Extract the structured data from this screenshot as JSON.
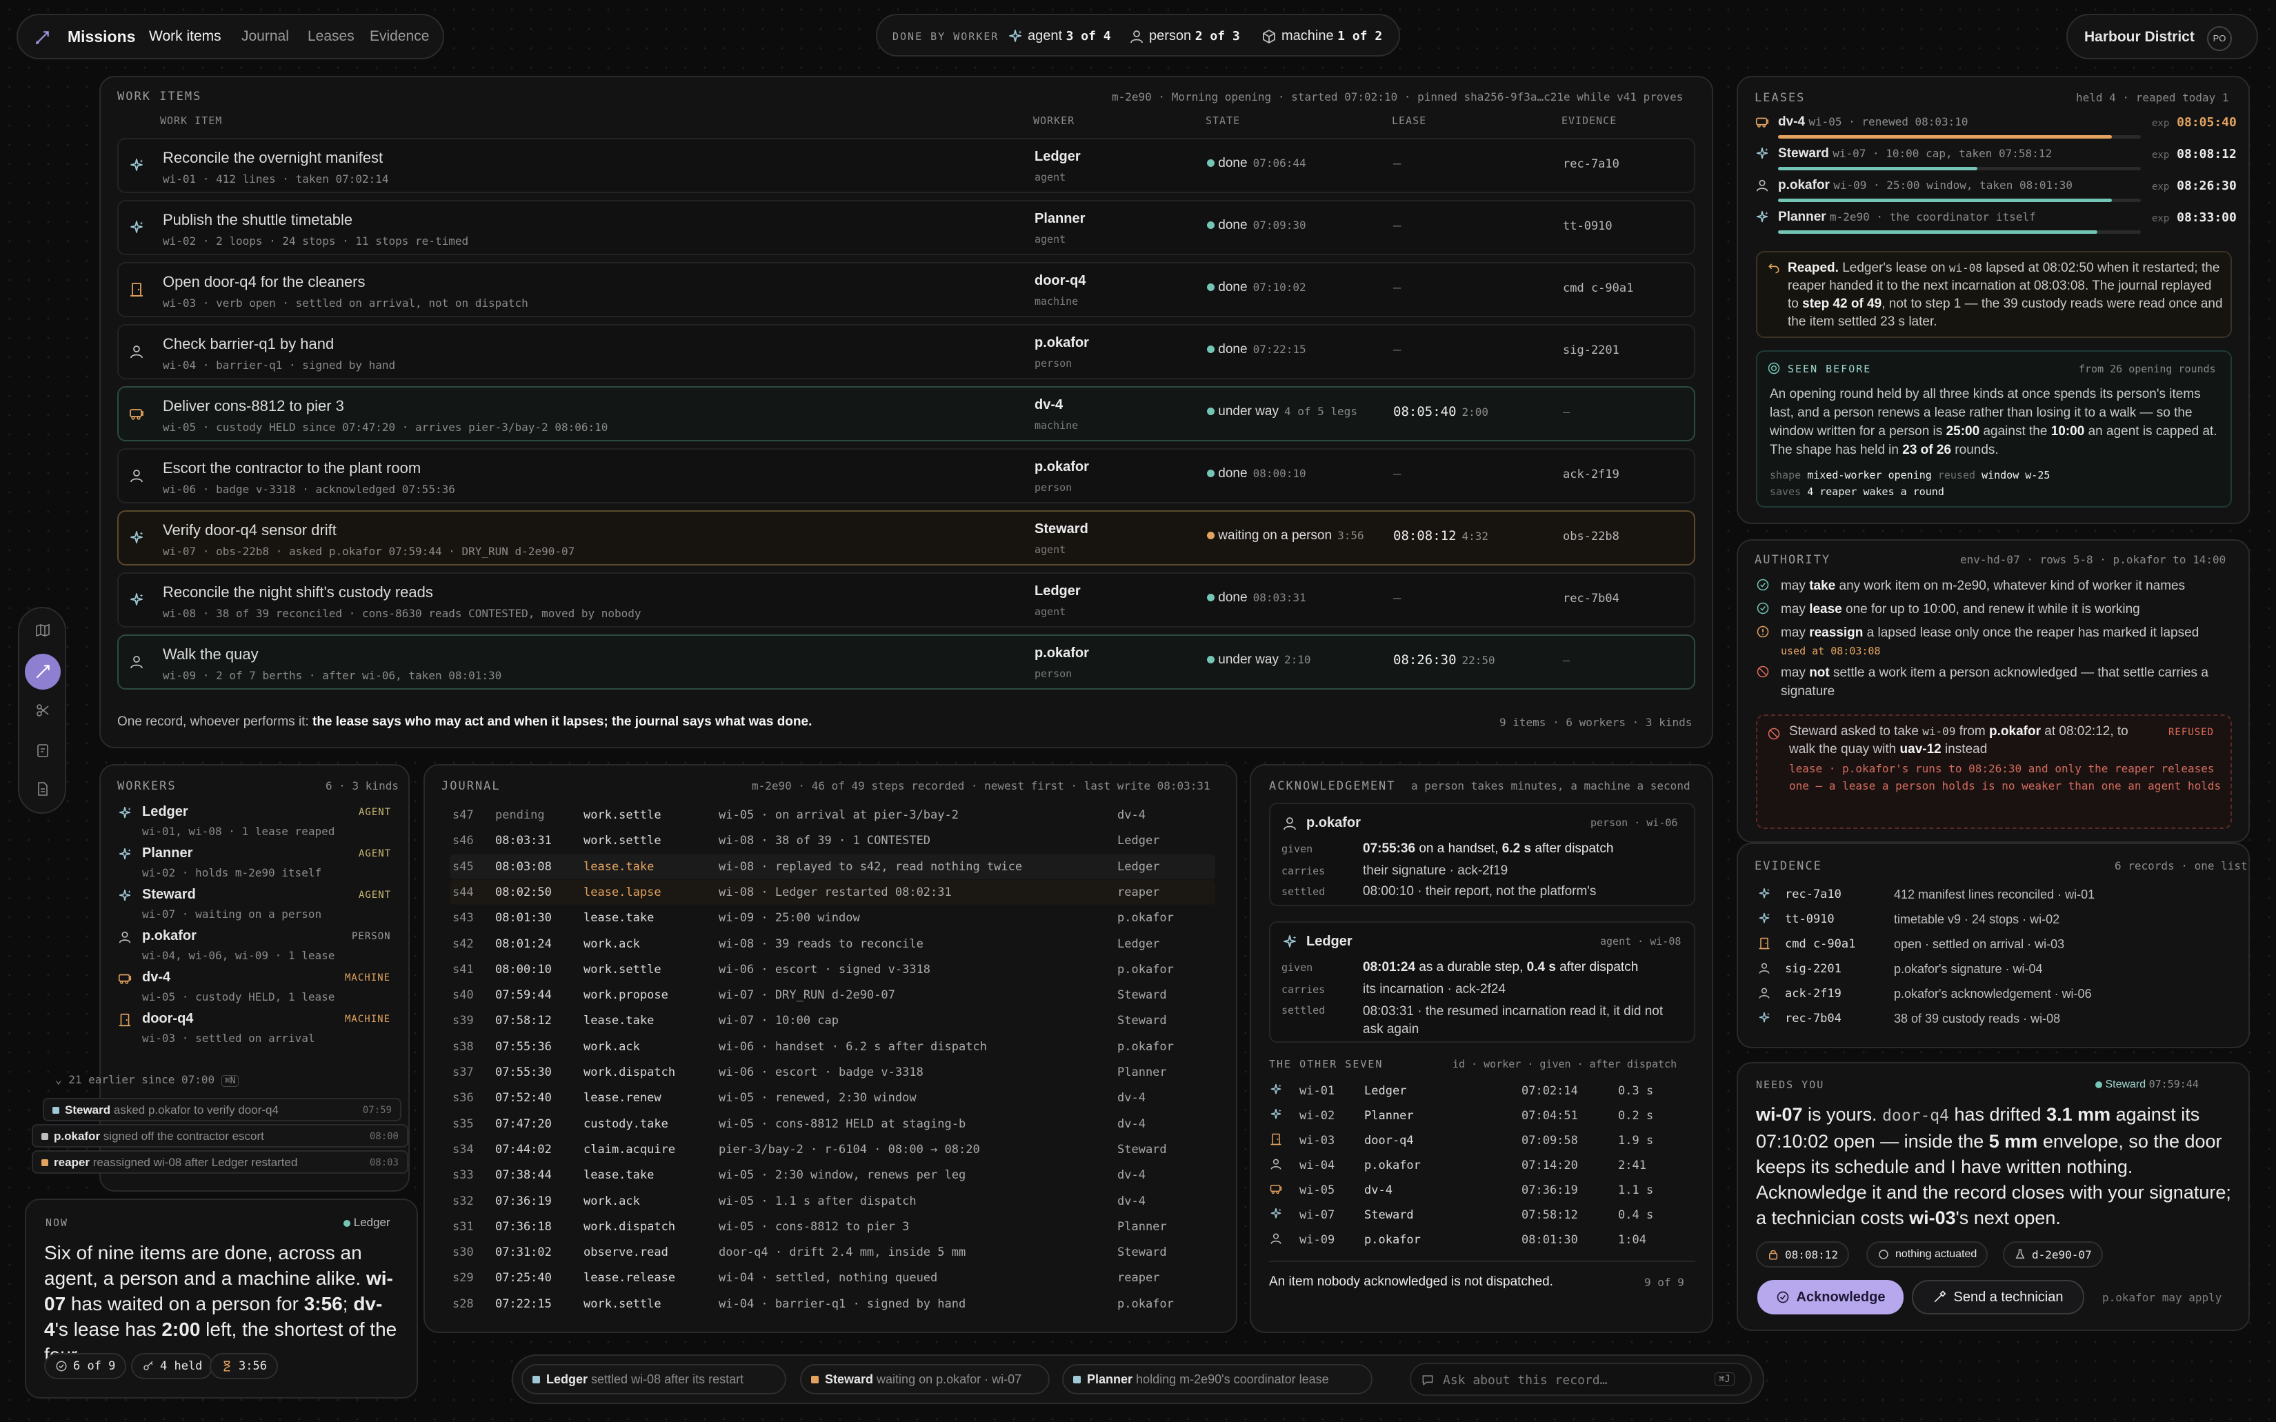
{
  "colors": {
    "accent": "#a594e0",
    "done": "#73c6b6",
    "waiting": "#e3a35f",
    "under_way": "#73c6b6",
    "refused": "#e06b5a",
    "badge_agent": "#c8b872",
    "badge_machine": "#e3a35f"
  },
  "topnav": {
    "title": "Missions",
    "tabs": [
      "Work items",
      "Journal",
      "Leases",
      "Evidence"
    ],
    "active": "Work items"
  },
  "done_by_worker": {
    "label": "DONE BY WORKER",
    "agent_label": "agent",
    "agent_val": "3 of 4",
    "person_label": "person",
    "person_val": "2 of 3",
    "machine_label": "machine",
    "machine_val": "1 of 2"
  },
  "district": {
    "name": "Harbour District",
    "initials": "PO"
  },
  "work_items": {
    "title": "WORK ITEMS",
    "meta": "m-2e90 · Morning opening · started 07:02:10 · pinned sha256-9f3a…c21e while v41 proves",
    "columns": [
      "WORK ITEM",
      "WORKER",
      "STATE",
      "LEASE",
      "EVIDENCE"
    ],
    "rows": [
      {
        "icon": "agent-icon",
        "title": "Reconcile the overnight manifest",
        "meta": "wi-01 · 412 lines · taken 07:02:14",
        "worker": "Ledger",
        "kind": "agent",
        "state": "done",
        "state_time": "07:06:44",
        "lease": "—",
        "lease_extra": "",
        "evidence": "rec-7a10"
      },
      {
        "icon": "agent-icon",
        "title": "Publish the shuttle timetable",
        "meta": "wi-02 · 2 loops · 24 stops · 11 stops re-timed",
        "worker": "Planner",
        "kind": "agent",
        "state": "done",
        "state_time": "07:09:30",
        "lease": "—",
        "lease_extra": "",
        "evidence": "tt-0910"
      },
      {
        "icon": "door-icon",
        "title": "Open door-q4 for the cleaners",
        "meta": "wi-03 · verb open · settled on arrival, not on dispatch",
        "worker": "door-q4",
        "kind": "machine",
        "state": "done",
        "state_time": "07:10:02",
        "lease": "—",
        "lease_extra": "",
        "evidence": "cmd c-90a1"
      },
      {
        "icon": "person-icon",
        "title": "Check barrier-q1 by hand",
        "meta": "wi-04 · barrier-q1 · signed by hand",
        "worker": "p.okafor",
        "kind": "person",
        "state": "done",
        "state_time": "07:22:15",
        "lease": "—",
        "lease_extra": "",
        "evidence": "sig-2201"
      },
      {
        "icon": "shuttle-icon",
        "title": "Deliver cons-8812 to pier 3",
        "meta": "wi-05 · custody HELD since 07:47:20 · arrives pier-3/bay-2 08:06:10",
        "worker": "dv-4",
        "kind": "machine",
        "state": "under way",
        "state_time": "4 of 5 legs",
        "lease": "08:05:40",
        "lease_extra": "2:00",
        "evidence": "—"
      },
      {
        "icon": "person-icon",
        "title": "Escort the contractor to the plant room",
        "meta": "wi-06 · badge v-3318 · acknowledged 07:55:36",
        "worker": "p.okafor",
        "kind": "person",
        "state": "done",
        "state_time": "08:00:10",
        "lease": "—",
        "lease_extra": "",
        "evidence": "ack-2f19"
      },
      {
        "icon": "agent-icon",
        "title": "Verify door-q4 sensor drift",
        "meta": "wi-07 · obs-22b8 · asked p.okafor 07:59:44 · DRY_RUN d-2e90-07",
        "worker": "Steward",
        "kind": "agent",
        "state": "waiting on a person",
        "state_time": "3:56",
        "lease": "08:08:12",
        "lease_extra": "4:32",
        "evidence": "obs-22b8"
      },
      {
        "icon": "agent-icon",
        "title": "Reconcile the night shift's custody reads",
        "meta": "wi-08 · 38 of 39 reconciled · cons-8630 reads CONTESTED, moved by nobody",
        "worker": "Ledger",
        "kind": "agent",
        "state": "done",
        "state_time": "08:03:31",
        "lease": "—",
        "lease_extra": "",
        "evidence": "rec-7b04"
      },
      {
        "icon": "person-icon",
        "title": "Walk the quay",
        "meta": "wi-09 · 2 of 7 berths · after wi-06, taken 08:01:30",
        "worker": "p.okafor",
        "kind": "person",
        "state": "under way",
        "state_time": "2:10",
        "lease": "08:26:30",
        "lease_extra": "22:50",
        "evidence": "—"
      }
    ],
    "footer_lead": "One record, whoever performs it:",
    "footer_bold": "the lease says who may act and when it lapses; the journal says what was done.",
    "footer_counts": "9 items · 6 workers · 3 kinds"
  },
  "workers": {
    "title": "WORKERS",
    "meta": "6 · 3 kinds",
    "items": [
      {
        "icon": "agent-icon",
        "name": "Ledger",
        "badge": "AGENT",
        "sub": "wi-01, wi-08 · 1 lease reaped"
      },
      {
        "icon": "agent-icon",
        "name": "Planner",
        "badge": "AGENT",
        "sub": "wi-02 · holds m-2e90 itself"
      },
      {
        "icon": "agent-icon",
        "name": "Steward",
        "badge": "AGENT",
        "sub": "wi-07 · waiting on a person"
      },
      {
        "icon": "person-icon",
        "name": "p.okafor",
        "badge": "PERSON",
        "sub": "wi-04, wi-06, wi-09 · 1 lease"
      },
      {
        "icon": "shuttle-icon",
        "name": "dv-4",
        "badge": "MACHINE",
        "sub": "wi-05 · custody HELD, 1 lease"
      },
      {
        "icon": "door-icon",
        "name": "door-q4",
        "badge": "MACHINE",
        "sub": "wi-03 · settled on arrival"
      }
    ]
  },
  "earlier": {
    "label": "21 earlier since 07:00",
    "key": "⌘N"
  },
  "toasts": [
    {
      "who": "Steward",
      "text": "asked p.okafor to verify door-q4",
      "time": "07:59"
    },
    {
      "who": "p.okafor",
      "text": "signed off the contractor escort",
      "time": "08:00"
    },
    {
      "who": "reaper",
      "text": "reassigned wi-08 after Ledger restarted",
      "time": "08:03"
    }
  ],
  "now": {
    "label": "NOW",
    "source": "Ledger",
    "t1": "Six of nine items are done, across an agent, a person and a machine alike. ",
    "b1": "wi-07",
    "t2": " has waited on a person for ",
    "b2": "3:56",
    "t3": "; ",
    "b3": "dv-4",
    "t4": "'s lease has ",
    "b4": "2:00",
    "t5": " left, the shortest of the four.",
    "chip1": "6 of 9",
    "chip2": "4 held",
    "chip3": "3:56"
  },
  "journal": {
    "title": "JOURNAL",
    "meta": "m-2e90 · 46 of 49 steps recorded · newest first · last write 08:03:31",
    "rows": [
      [
        "s47",
        "pending",
        "work.settle",
        "wi-05 · on arrival at pier-3/bay-2",
        "dv-4"
      ],
      [
        "s46",
        "08:03:31",
        "work.settle",
        "wi-08 · 38 of 39 · 1 CONTESTED",
        "Ledger"
      ],
      [
        "s45",
        "08:03:08",
        "lease.take",
        "wi-08 · replayed to s42, read nothing twice",
        "Ledger"
      ],
      [
        "s44",
        "08:02:50",
        "lease.lapse",
        "wi-08 · Ledger restarted 08:02:31",
        "reaper"
      ],
      [
        "s43",
        "08:01:30",
        "lease.take",
        "wi-09 · 25:00 window",
        "p.okafor"
      ],
      [
        "s42",
        "08:01:24",
        "work.ack",
        "wi-08 · 39 reads to reconcile",
        "Ledger"
      ],
      [
        "s41",
        "08:00:10",
        "work.settle",
        "wi-06 · escort · signed v-3318",
        "p.okafor"
      ],
      [
        "s40",
        "07:59:44",
        "work.propose",
        "wi-07 · DRY_RUN d-2e90-07",
        "Steward"
      ],
      [
        "s39",
        "07:58:12",
        "lease.take",
        "wi-07 · 10:00 cap",
        "Steward"
      ],
      [
        "s38",
        "07:55:36",
        "work.ack",
        "wi-06 · handset · 6.2 s after dispatch",
        "p.okafor"
      ],
      [
        "s37",
        "07:55:30",
        "work.dispatch",
        "wi-06 · escort · badge v-3318",
        "Planner"
      ],
      [
        "s36",
        "07:52:40",
        "lease.renew",
        "wi-05 · renewed, 2:30 window",
        "dv-4"
      ],
      [
        "s35",
        "07:47:20",
        "custody.take",
        "wi-05 · cons-8812 HELD at staging-b",
        "dv-4"
      ],
      [
        "s34",
        "07:44:02",
        "claim.acquire",
        "pier-3/bay-2 · r-6104 · 08:00 → 08:20",
        "Steward"
      ],
      [
        "s33",
        "07:38:44",
        "lease.take",
        "wi-05 · 2:30 window, renews per leg",
        "dv-4"
      ],
      [
        "s32",
        "07:36:19",
        "work.ack",
        "wi-05 · 1.1 s after dispatch",
        "dv-4"
      ],
      [
        "s31",
        "07:36:18",
        "work.dispatch",
        "wi-05 · cons-8812 to pier 3",
        "Planner"
      ],
      [
        "s30",
        "07:31:02",
        "observe.read",
        "door-q4 · drift 2.4 mm, inside 5 mm",
        "Steward"
      ],
      [
        "s29",
        "07:25:40",
        "lease.release",
        "wi-04 · settled, nothing queued",
        "reaper"
      ],
      [
        "s28",
        "07:22:15",
        "work.settle",
        "wi-04 · barrier-q1 · signed by hand",
        "p.okafor"
      ]
    ]
  },
  "ack": {
    "title": "ACKNOWLEDGEMENT",
    "meta": "a person takes minutes, a machine a second",
    "p_name": "p.okafor",
    "p_meta": "person · wi-06",
    "p_given_t": "07:55:36",
    "p_given_rest": " on a handset, ",
    "p_given_b": "6.2 s",
    "p_given_tail": " after dispatch",
    "p_carries": "their signature · ack-2f19",
    "p_settled": "08:00:10 · their report, not the platform's",
    "l_name": "Ledger",
    "l_meta": "agent · wi-08",
    "l_given_t": "08:01:24",
    "l_given_rest": " as a durable step, ",
    "l_given_b": "0.4 s",
    "l_given_tail": " after dispatch",
    "l_carries": "its incarnation · ack-2f24",
    "l_settled": "08:03:31 · the resumed incarnation read it, it did not ask again",
    "lbl_given": "given",
    "lbl_carries": "carries",
    "lbl_settled": "settled",
    "other_title": "THE OTHER SEVEN",
    "other_cols": "id · worker · given · after dispatch",
    "others": [
      {
        "icon": "agent-icon",
        "id": "wi-01",
        "worker": "Ledger",
        "given": "07:02:14",
        "after": "0.3 s"
      },
      {
        "icon": "agent-icon",
        "id": "wi-02",
        "worker": "Planner",
        "given": "07:04:51",
        "after": "0.2 s"
      },
      {
        "icon": "door-icon",
        "id": "wi-03",
        "worker": "door-q4",
        "given": "07:09:58",
        "after": "1.9 s"
      },
      {
        "icon": "person-icon",
        "id": "wi-04",
        "worker": "p.okafor",
        "given": "07:14:20",
        "after": "2:41"
      },
      {
        "icon": "shuttle-icon",
        "id": "wi-05",
        "worker": "dv-4",
        "given": "07:36:19",
        "after": "1.1 s"
      },
      {
        "icon": "agent-icon",
        "id": "wi-07",
        "worker": "Steward",
        "given": "07:58:12",
        "after": "0.4 s"
      },
      {
        "icon": "person-icon",
        "id": "wi-09",
        "worker": "p.okafor",
        "given": "08:01:30",
        "after": "1:04"
      }
    ],
    "footer": "An item nobody acknowledged is not dispatched.",
    "footer_count": "9 of 9"
  },
  "leases": {
    "title": "LEASES",
    "meta": "held 4 · reaped today 1",
    "items": [
      {
        "icon": "shuttle-icon",
        "name": "dv-4",
        "meta": "wi-05 · renewed 08:03:10",
        "exp_label": "exp",
        "exp": "08:05:40",
        "fill": 0.92,
        "color": "#e3a35f"
      },
      {
        "icon": "agent-icon",
        "name": "Steward",
        "meta": "wi-07 · 10:00 cap, taken 07:58:12",
        "exp_label": "exp",
        "exp": "08:08:12",
        "fill": 0.55,
        "color": "#73c6b6"
      },
      {
        "icon": "person-icon",
        "name": "p.okafor",
        "meta": "wi-09 · 25:00 window, taken 08:01:30",
        "exp_label": "exp",
        "exp": "08:26:30",
        "fill": 0.92,
        "color": "#73c6b6"
      },
      {
        "icon": "agent-icon",
        "name": "Planner",
        "meta": "m-2e90 · the coordinator itself",
        "exp_label": "exp",
        "exp": "08:33:00",
        "fill": 0.88,
        "color": "#73c6b6"
      }
    ],
    "reaped_b": "Reaped.",
    "reaped_t1": " Ledger's lease on ",
    "reaped_c1": "wi-08",
    "reaped_t2": " lapsed at 08:02:50 when it restarted; the reaper handed it to the next incarnation at 08:03:08. The journal replayed to ",
    "reaped_b2": "step 42 of 49",
    "reaped_t3": ", not to step 1 — the 39 custody reads were read once and the item settled 23 s later.",
    "seen_title": "SEEN BEFORE",
    "seen_meta": "from 26 opening rounds",
    "seen_t1": "An opening round held by all three kinds at once spends its person's items last, and a person renews a lease rather than losing it to a walk — so the window written for a person is ",
    "seen_b1": "25:00",
    "seen_t2": " against the ",
    "seen_b2": "10:00",
    "seen_t3": " an agent is capped at. The shape has held in ",
    "seen_b3": "23 of 26",
    "seen_t4": " rounds.",
    "seen_shape_l": "shape",
    "seen_shape_v": "mixed-worker opening",
    "seen_reused_l": "reused",
    "seen_reused_v": "window w-25",
    "seen_saves_l": "saves",
    "seen_saves_v": "4 reaper wakes a round"
  },
  "authority": {
    "title": "AUTHORITY",
    "meta": "env-hd-07 · rows 5-8 · p.okafor to 14:00",
    "rules": [
      {
        "icon": "check-icon",
        "pre": "may ",
        "b": "take",
        "post": " any work item on m-2e90, whatever kind of worker it names",
        "sub": ""
      },
      {
        "icon": "check-icon",
        "pre": "may ",
        "b": "lease",
        "post": " one for up to 10:00, and renew it while it is working",
        "sub": ""
      },
      {
        "icon": "warn-icon",
        "pre": "may ",
        "b": "reassign",
        "post": " a lapsed lease only once the reaper has marked it lapsed",
        "sub": "used at 08:03:08"
      },
      {
        "icon": "deny-icon",
        "pre": "may ",
        "b": "not",
        "post": " settle a work item a person acknowledged — that settle carries a signature",
        "sub": ""
      }
    ],
    "refused_t1": "Steward asked to take ",
    "refused_c1": "wi-09",
    "refused_t2": " from ",
    "refused_b1": "p.okafor",
    "refused_t3": " at 08:02:12, to walk the quay with ",
    "refused_b2": "uav-12",
    "refused_t4": " instead",
    "refused_badge": "REFUSED",
    "refused_reason": "lease · p.okafor's runs to 08:26:30 and only the reaper releases one — a lease a person holds is no weaker than one an agent holds"
  },
  "evidence": {
    "title": "EVIDENCE",
    "meta": "6 records · one list",
    "items": [
      {
        "icon": "agent-icon",
        "id": "rec-7a10",
        "desc": "412 manifest lines reconciled · wi-01"
      },
      {
        "icon": "agent-icon",
        "id": "tt-0910",
        "desc": "timetable v9 · 24 stops · wi-02"
      },
      {
        "icon": "door-icon",
        "id": "cmd c-90a1",
        "desc": "open · settled on arrival · wi-03"
      },
      {
        "icon": "person-icon",
        "id": "sig-2201",
        "desc": "p.okafor's signature · wi-04"
      },
      {
        "icon": "person-icon",
        "id": "ack-2f19",
        "desc": "p.okafor's acknowledgement · wi-06"
      },
      {
        "icon": "agent-icon",
        "id": "rec-7b04",
        "desc": "38 of 39 custody reads · wi-08"
      }
    ]
  },
  "needs": {
    "title": "NEEDS YOU",
    "source": "Steward",
    "time": "07:59:44",
    "b1": "wi-07",
    "t1": " is yours. ",
    "c1": "door-q4",
    "t2": " has drifted ",
    "b2": "3.1 mm",
    "t3": " against its 07:10:02 open — inside the ",
    "b3": "5 mm",
    "t4": " envelope, so the door keeps its schedule and I have written nothing. Acknowledge it and the record closes with your signature; a technician costs ",
    "b4": "wi-03",
    "t5": "'s next open.",
    "chip1": "08:08:12",
    "chip2": "nothing actuated",
    "chip3": "d-2e90-07",
    "ack_btn": "Acknowledge",
    "tech_btn": "Send a technician",
    "note": "p.okafor may apply"
  },
  "bottombar": {
    "items": [
      {
        "who": "Ledger",
        "text": "settled wi-08 after its restart"
      },
      {
        "who": "Steward",
        "text": "waiting on p.okafor · wi-07"
      },
      {
        "who": "Planner",
        "text": "holding m-2e90's coordinator lease"
      }
    ],
    "ask_placeholder": "Ask about this record…",
    "ask_key": "⌘J"
  }
}
